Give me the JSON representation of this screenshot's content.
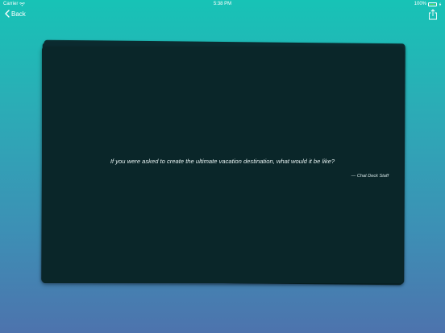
{
  "status_bar": {
    "carrier": "Carrier",
    "time": "5:38 PM",
    "battery": "100%"
  },
  "nav": {
    "back_label": "Back",
    "back_icon": "chevron-left-icon",
    "share_icon": "share-icon"
  },
  "card": {
    "question": "If you were asked to create the ultimate vacation destination, what would it be like?",
    "attribution": "— Chat Deck Staff"
  },
  "colors": {
    "gradient_top": "#17c3b6",
    "gradient_bottom": "#4d73ad",
    "card_background": "#0a2629",
    "battery_fill": "#4cd964"
  }
}
